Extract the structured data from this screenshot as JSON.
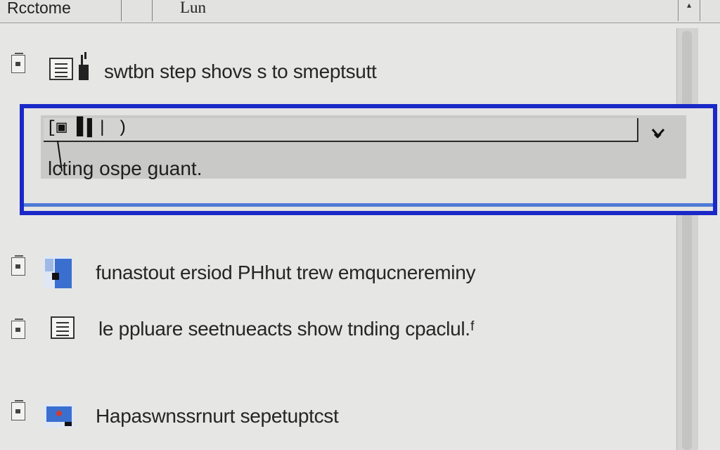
{
  "header": {
    "title": "Rcctome",
    "list_label": "Lun",
    "corner_glyph": "▴"
  },
  "rows": [
    {
      "label": "swtbn step shovs s to smeptsutt"
    },
    {
      "input_value": "[▣ ▋▌| )",
      "sub_label": "lcting ospe guant."
    },
    {
      "label": "funastout ersiod PHhut trew emqucnereminy"
    },
    {
      "label": "le ppluare seetnueacts show tnding cpaclul.ᶠ"
    },
    {
      "label": "Hapaswnssrnurt sepetuptcst"
    }
  ],
  "colors": {
    "selection_border": "#1a28c8",
    "selection_underline": "#4f7bd6",
    "app_icon_blue": "#3a6fd0"
  }
}
